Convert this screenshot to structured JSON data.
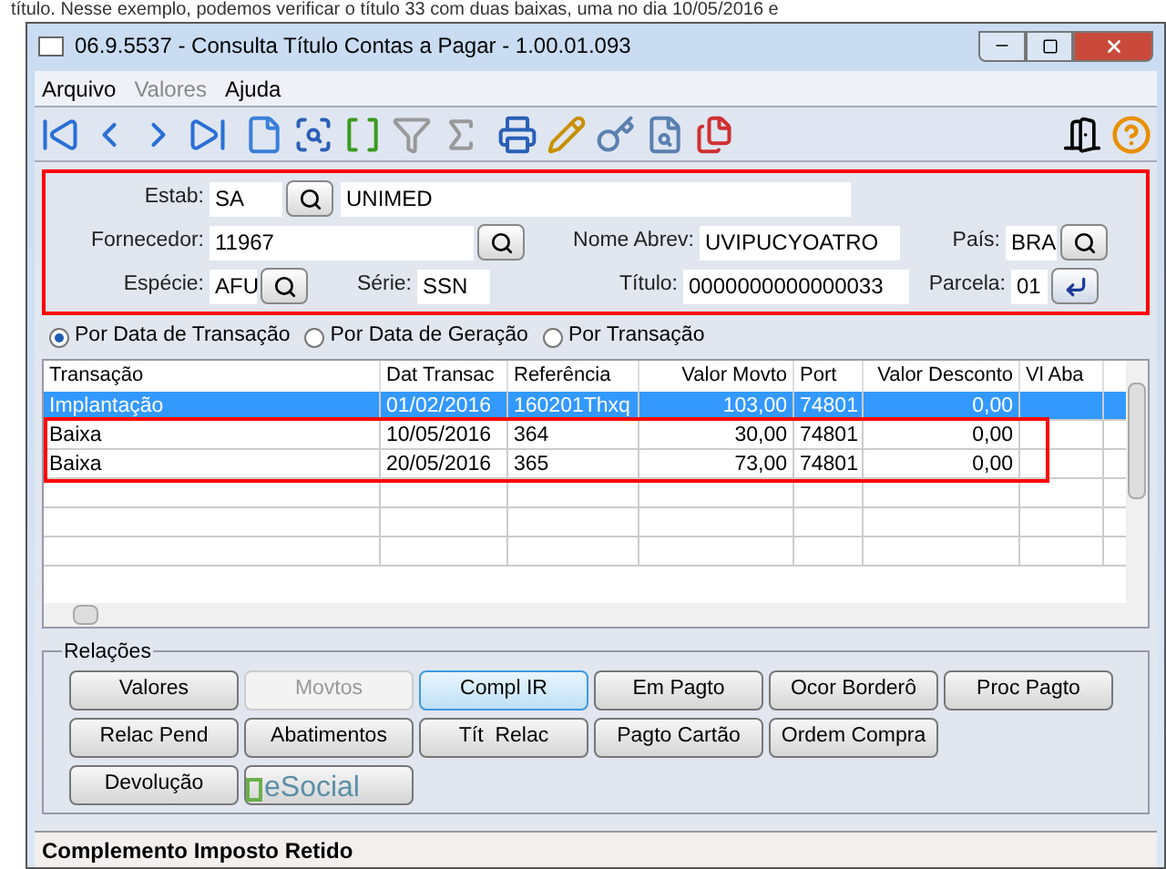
{
  "document_text": "título. Nesse exemplo, podemos verificar o título 33 com duas baixas, uma no dia 10/05/2016 e",
  "window": {
    "title": "06.9.5537 - Consulta Título Contas a Pagar - 1.00.01.093"
  },
  "menu": [
    {
      "label": "Arquivo",
      "disabled": false
    },
    {
      "label": "Valores",
      "disabled": true
    },
    {
      "label": "Ajuda",
      "disabled": false
    }
  ],
  "header": {
    "highlighted": true,
    "estab": {
      "label": "Estab:",
      "code": "SA",
      "name": "UNIMED"
    },
    "fornecedor": {
      "label": "Fornecedor:",
      "value": "11967"
    },
    "nome_abrev": {
      "label": "Nome Abrev:",
      "value": "UVIPUCYOATRO"
    },
    "pais": {
      "label": "País:",
      "value": "BRA"
    },
    "especie": {
      "label": "Espécie:",
      "value": "AFU"
    },
    "serie": {
      "label": "Série:",
      "value": "SSN"
    },
    "titulo": {
      "label": "Título:",
      "value": "0000000000000033"
    },
    "parcela": {
      "label": "Parcela:",
      "value": "01"
    }
  },
  "radios": [
    {
      "label": "Por Data de Transação",
      "selected": true
    },
    {
      "label": "Por Data de Geração",
      "selected": false
    },
    {
      "label": "Por Transação",
      "selected": false
    }
  ],
  "table": {
    "columns": [
      "Transação",
      "Dat Transac",
      "Referência",
      "Valor Movto",
      "Port",
      "Valor Desconto",
      "Vl Aba"
    ],
    "rows": [
      {
        "cells": [
          "Implantação",
          "01/02/2016",
          "160201Thxq",
          "103,00",
          "74801",
          "0,00",
          ""
        ],
        "selected": true,
        "highlighted": false
      },
      {
        "cells": [
          "Baixa",
          "10/05/2016",
          "364",
          "30,00",
          "74801",
          "0,00",
          ""
        ],
        "selected": false,
        "highlighted": true
      },
      {
        "cells": [
          "Baixa",
          "20/05/2016",
          "365",
          "73,00",
          "74801",
          "0,00",
          ""
        ],
        "selected": false,
        "highlighted": true
      }
    ]
  },
  "relacoes": {
    "title": "Relações",
    "button_rows": [
      [
        {
          "label": "Valores",
          "kind": "text",
          "disabled": false,
          "focused": false
        },
        {
          "label": "Movtos",
          "kind": "text",
          "disabled": true,
          "focused": false
        },
        {
          "label": "Compl IR",
          "kind": "text",
          "disabled": false,
          "focused": true
        },
        {
          "label": "Em Pagto",
          "kind": "text",
          "disabled": false,
          "focused": false
        },
        {
          "label": "Ocor Borderô",
          "kind": "text",
          "disabled": false,
          "focused": false
        },
        {
          "label": "Proc Pagto",
          "kind": "text",
          "disabled": false,
          "focused": false
        }
      ],
      [
        {
          "label": "Relac Pend",
          "kind": "text",
          "disabled": false,
          "focused": false
        },
        {
          "label": "Abatimentos",
          "kind": "text",
          "disabled": false,
          "focused": false
        },
        {
          "label": "Tít  Relac",
          "kind": "text",
          "disabled": false,
          "focused": false
        },
        {
          "label": "Pagto Cartão",
          "kind": "text",
          "disabled": false,
          "focused": false
        },
        {
          "label": "Ordem Compra",
          "kind": "text",
          "disabled": false,
          "focused": false
        }
      ],
      [
        {
          "label": "Devolução",
          "kind": "text",
          "disabled": false,
          "focused": false
        },
        {
          "label": "eSocial",
          "kind": "logo",
          "disabled": false,
          "focused": false
        }
      ]
    ]
  },
  "status_bar": "Complemento Imposto Retido"
}
